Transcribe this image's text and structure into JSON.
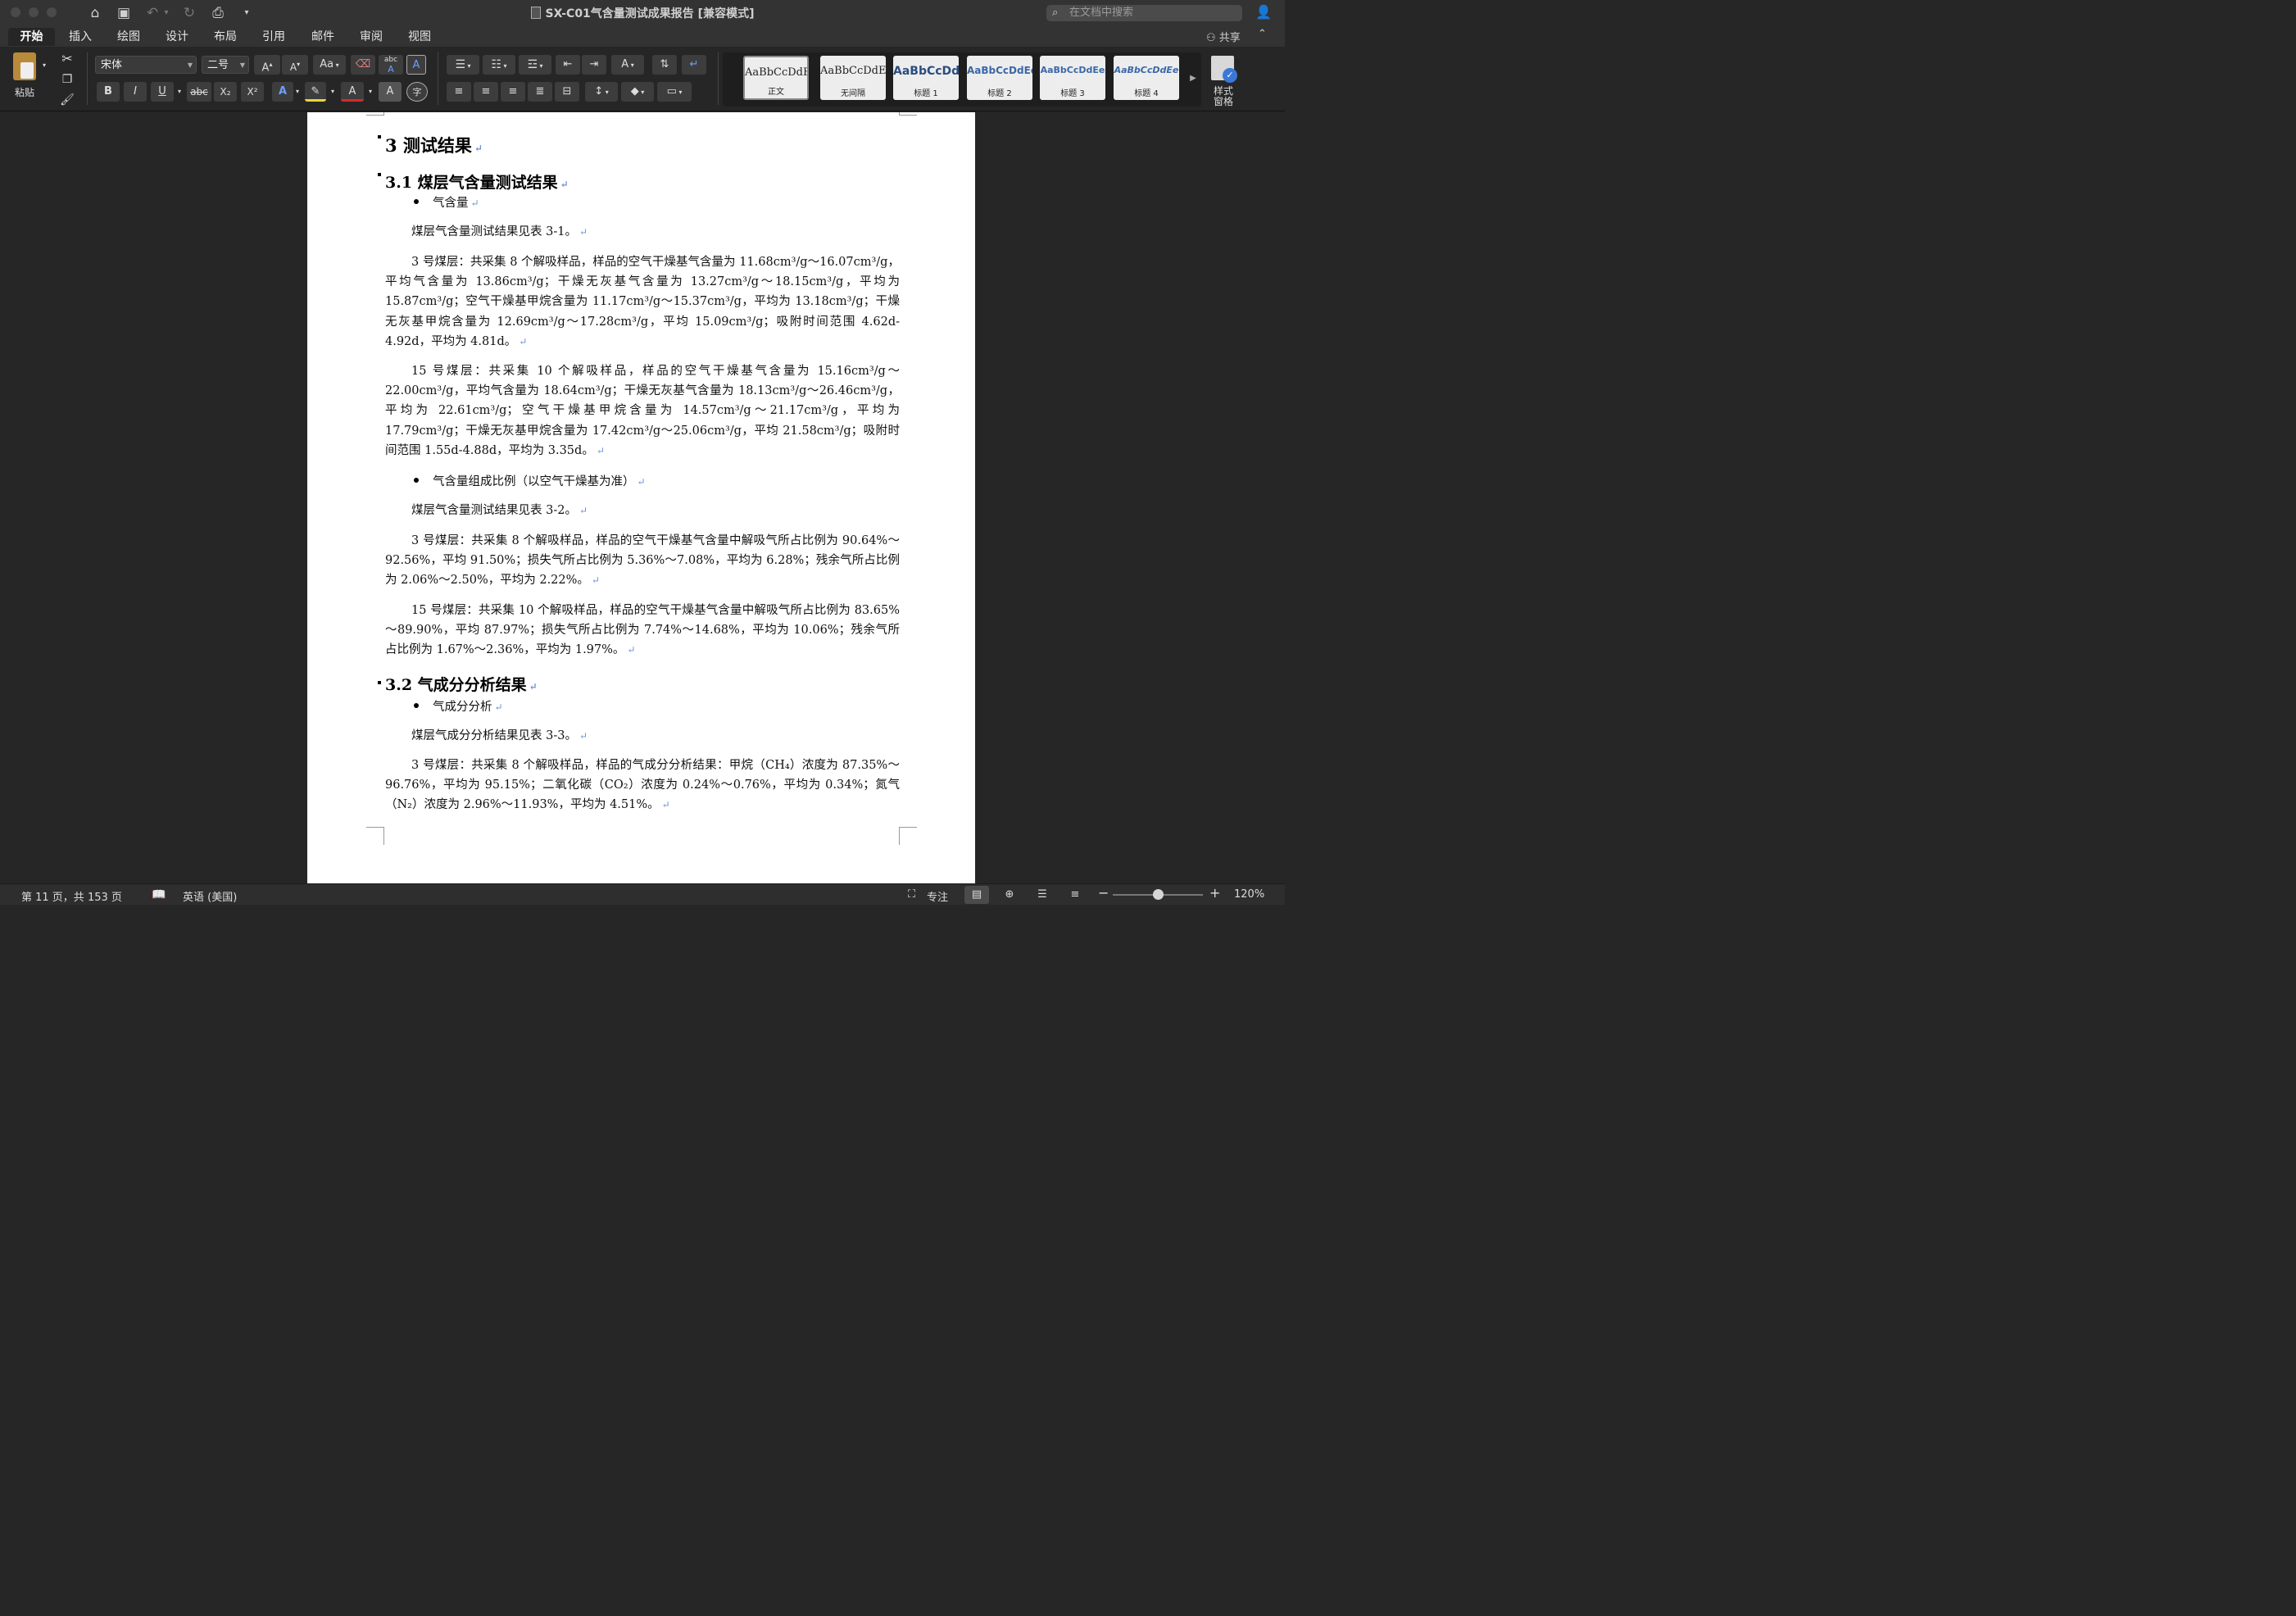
{
  "window": {
    "title": "SX-C01气含量测试成果报告 [兼容模式]",
    "search_placeholder": "在文档中搜索"
  },
  "quick_access": {
    "icons": [
      "home-icon",
      "save-icon",
      "undo-icon",
      "redo-icon",
      "print-icon",
      "customize-icon"
    ]
  },
  "tabs": [
    {
      "label": "开始",
      "active": true
    },
    {
      "label": "插入",
      "active": false
    },
    {
      "label": "绘图",
      "active": false
    },
    {
      "label": "设计",
      "active": false
    },
    {
      "label": "布局",
      "active": false
    },
    {
      "label": "引用",
      "active": false
    },
    {
      "label": "邮件",
      "active": false
    },
    {
      "label": "审阅",
      "active": false
    },
    {
      "label": "视图",
      "active": false
    }
  ],
  "share_label": "共享",
  "ribbon": {
    "paste_label": "粘贴",
    "font_name": "宋体",
    "font_size": "二号",
    "buttons": {
      "bold": "B",
      "italic": "I",
      "underline": "U",
      "strike": "abc",
      "subscript": "X₂",
      "superscript": "X²",
      "font_color": "A",
      "char_shading": "A",
      "phonetic": "字",
      "clear_format_sample": "abc",
      "case": "Aa"
    },
    "styles": [
      {
        "sample": "AaBbCcDdEe",
        "name": "正文",
        "selected": true
      },
      {
        "sample": "AaBbCcDdEe",
        "name": "无间隔",
        "selected": false
      },
      {
        "sample": "AaBbCcDdI",
        "name": "标题 1",
        "selected": false
      },
      {
        "sample": "AaBbCcDdEe",
        "name": "标题 2",
        "selected": false
      },
      {
        "sample": "AaBbCcDdEe",
        "name": "标题 3",
        "selected": false
      },
      {
        "sample": "AaBbCcDdEe",
        "name": "标题 4",
        "selected": false
      }
    ],
    "styles_pane_label": "样式窗格"
  },
  "document": {
    "h1": "3 测试结果",
    "h2_a": "3.1 煤层气含量测试结果",
    "bullet_a": "气含量",
    "p1": "煤层气含量测试结果见表 3-1。",
    "p2": "3 号煤层：共采集 8 个解吸样品，样品的空气干燥基气含量为 11.68cm³/g～16.07cm³/g，平均气含量为 13.86cm³/g；干燥无灰基气含量为 13.27cm³/g～18.15cm³/g，平均为 15.87cm³/g；空气干燥基甲烷含量为 11.17cm³/g～15.37cm³/g，平均为 13.18cm³/g；干燥无灰基甲烷含量为 12.69cm³/g～17.28cm³/g，平均 15.09cm³/g；吸附时间范围 4.62d-4.92d，平均为 4.81d。",
    "p3": "15 号煤层：共采集 10 个解吸样品，样品的空气干燥基气含量为 15.16cm³/g～22.00cm³/g，平均气含量为 18.64cm³/g；干燥无灰基气含量为 18.13cm³/g～26.46cm³/g，平均为 22.61cm³/g；空气干燥基甲烷含量为 14.57cm³/g～21.17cm³/g，平均为 17.79cm³/g；干燥无灰基甲烷含量为 17.42cm³/g～25.06cm³/g，平均 21.58cm³/g；吸附时间范围 1.55d-4.88d，平均为 3.35d。",
    "bullet_b": "气含量组成比例（以空气干燥基为准）",
    "p4": "煤层气含量测试结果见表 3-2。",
    "p5": "3 号煤层：共采集 8 个解吸样品，样品的空气干燥基气含量中解吸气所占比例为 90.64%～92.56%，平均 91.50%；损失气所占比例为 5.36%～7.08%，平均为 6.28%；残余气所占比例为 2.06%～2.50%，平均为 2.22%。",
    "p6": "15 号煤层：共采集 10 个解吸样品，样品的空气干燥基气含量中解吸气所占比例为 83.65%～89.90%，平均 87.97%；损失气所占比例为 7.74%～14.68%，平均为 10.06%；残余气所占比例为 1.67%～2.36%，平均为 1.97%。",
    "h2_b": "3.2 气成分分析结果",
    "bullet_c": "气成分分析",
    "p7": "煤层气成分分析结果见表 3-3。",
    "p8": "3 号煤层：共采集 8 个解吸样品，样品的气成分分析结果：甲烷（CH₄）浓度为 87.35%～96.76%，平均为 95.15%；二氧化碳（CO₂）浓度为 0.24%～0.76%，平均为 0.34%；氮气（N₂）浓度为 2.96%～11.93%，平均为 4.51%。",
    "return_mark": "↵"
  },
  "status": {
    "page_info": "第 11 页，共 153 页",
    "language": "英语 (美国)",
    "focus": "专注",
    "zoom": "120%",
    "zoom_level_fraction": 0.5
  }
}
